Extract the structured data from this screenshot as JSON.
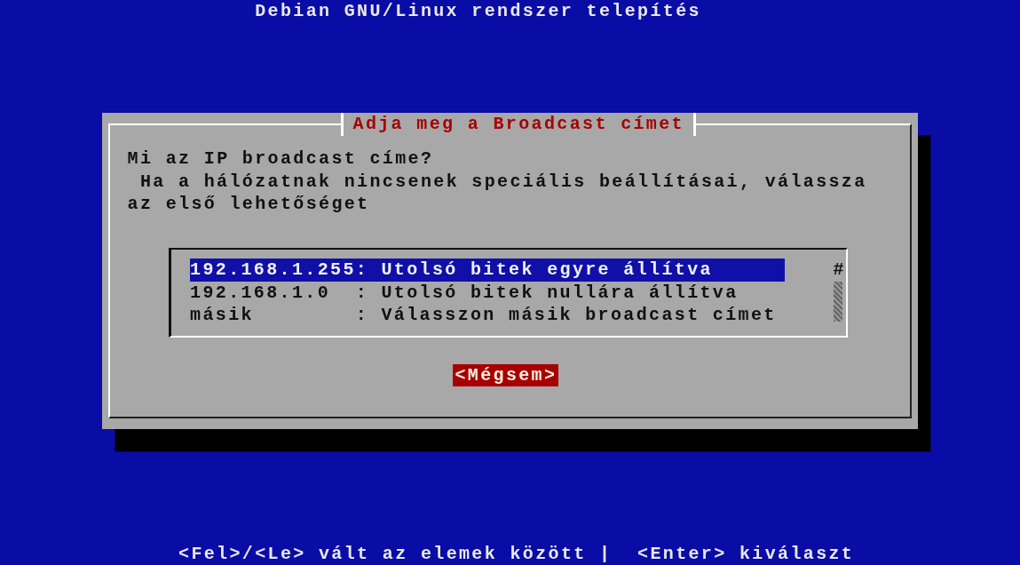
{
  "screen_title": "Debian GNU/Linux rendszer telepítés",
  "dialog": {
    "title": "Adja meg a Broadcast címet",
    "question": "Mi az IP broadcast címe?",
    "description": "Ha a hálózatnak nincsenek speciális beállításai, válassza az első lehetőséget",
    "options": [
      {
        "value": "192.168.1.255",
        "label": ": Utolsó bitek egyre állítva",
        "selected": true
      },
      {
        "value": "192.168.1.0",
        "label": ": Utolsó bitek nullára állítva",
        "selected": false
      },
      {
        "value": "másik",
        "label": ": Válasszon másik broadcast címet",
        "selected": false
      }
    ],
    "scroll_mark": "#",
    "buttons": [
      "<Mégsem>"
    ]
  },
  "help_line": "<Fel>/<Le> vált az elemek között |  <Enter> kiválaszt"
}
